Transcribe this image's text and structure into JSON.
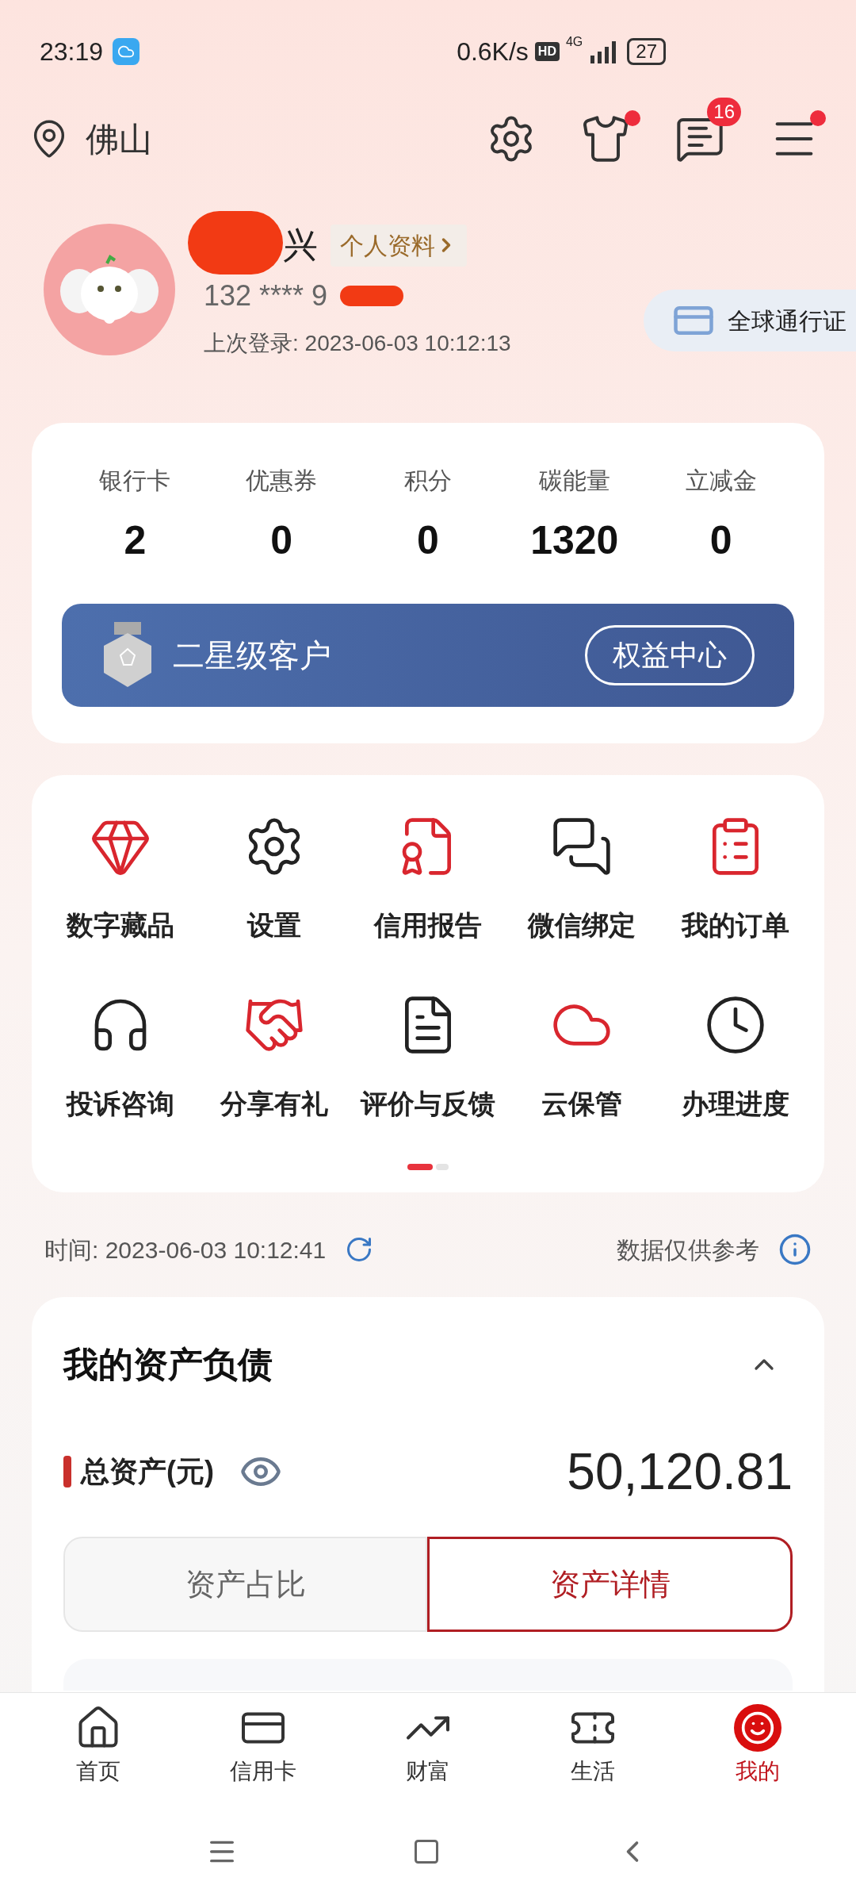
{
  "status_bar": {
    "time": "23:19",
    "speed": "0.6K/s",
    "hd": "HD",
    "network": "4G",
    "battery": "27"
  },
  "header": {
    "city": "佛山",
    "message_count": "16",
    "shirt_dot": true,
    "menu_dot": true
  },
  "profile": {
    "name": "兴",
    "profile_link": "个人资料",
    "phone": "132 **** 9",
    "last_login": "上次登录: 2023-06-03 10:12:13",
    "pass_badge": "全球通行证"
  },
  "stats": [
    {
      "label": "银行卡",
      "value": "2"
    },
    {
      "label": "优惠券",
      "value": "0"
    },
    {
      "label": "积分",
      "value": "0"
    },
    {
      "label": "碳能量",
      "value": "1320"
    },
    {
      "label": "立减金",
      "value": "0"
    }
  ],
  "member": {
    "level": "二星级客户",
    "button": "权益中心"
  },
  "shortcuts": [
    {
      "label": "数字藏品"
    },
    {
      "label": "设置"
    },
    {
      "label": "信用报告"
    },
    {
      "label": "微信绑定"
    },
    {
      "label": "我的订单"
    },
    {
      "label": "投诉咨询"
    },
    {
      "label": "分享有礼"
    },
    {
      "label": "评价与反馈"
    },
    {
      "label": "云保管"
    },
    {
      "label": "办理进度"
    }
  ],
  "pages": [
    {
      "selected": true
    },
    {
      "selected": false
    }
  ],
  "info_row": {
    "time": "时间: 2023-06-03 10:12:41",
    "note": "数据仅供参考"
  },
  "assets": {
    "title": "我的资产负债",
    "expanded": true,
    "total_label": "总资产(元)",
    "total": "50,120.81",
    "tabs": [
      {
        "label": "资产占比",
        "selected": false
      },
      {
        "label": "资产详情",
        "selected": true
      }
    ]
  },
  "bottom_nav": [
    {
      "label": "首页",
      "selected": false
    },
    {
      "label": "信用卡",
      "selected": false
    },
    {
      "label": "财富",
      "selected": false
    },
    {
      "label": "生活",
      "selected": false
    },
    {
      "label": "我的",
      "selected": true
    }
  ]
}
